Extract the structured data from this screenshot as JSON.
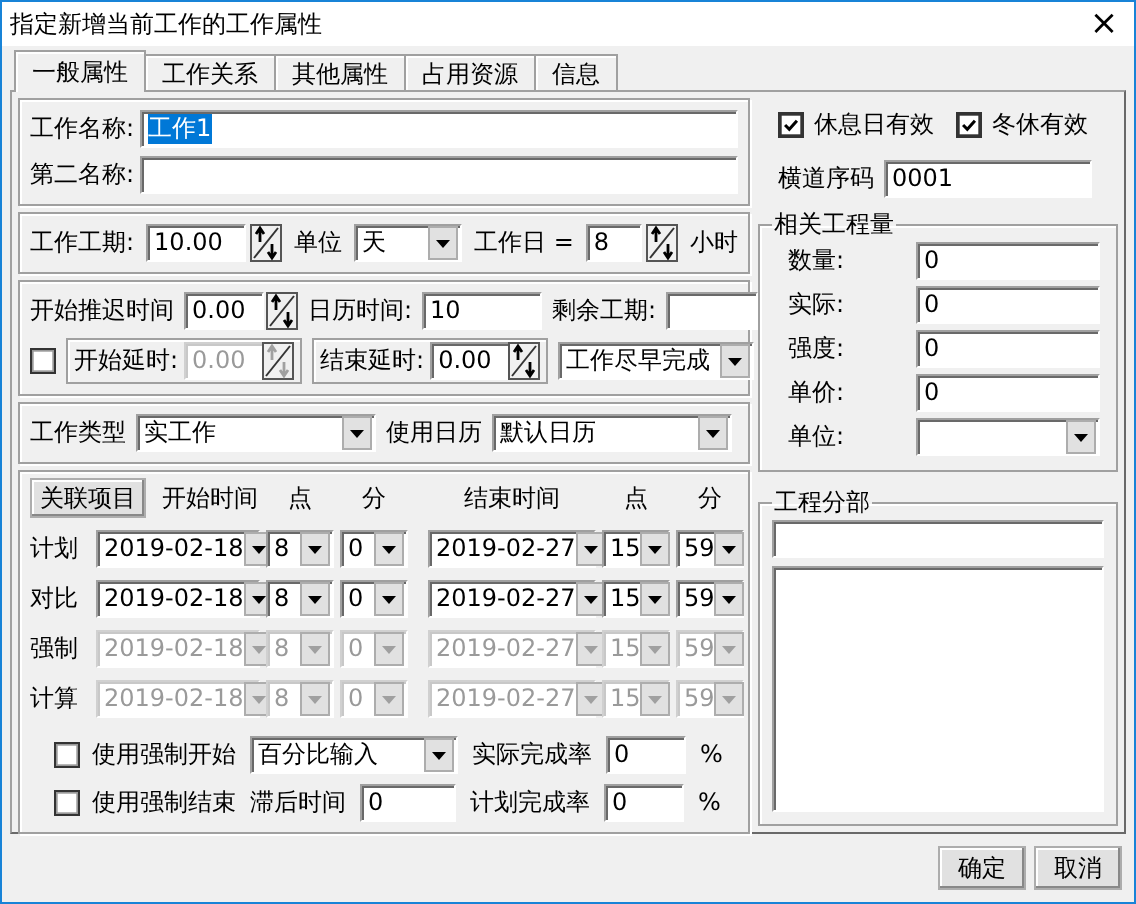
{
  "window": {
    "title": "指定新增当前工作的工作属性",
    "close_glyph": "×"
  },
  "tabs": [
    {
      "label": "一般属性",
      "selected": true
    },
    {
      "label": "工作关系",
      "selected": false
    },
    {
      "label": "其他属性",
      "selected": false
    },
    {
      "label": "占用资源",
      "selected": false
    },
    {
      "label": "信息",
      "selected": false
    }
  ],
  "name_field": {
    "label": "工作名称:",
    "value": "工作1",
    "text_selected": true
  },
  "second_name_field": {
    "label": "第二名称:"
  },
  "duration_row": [
    {
      "kind": "label",
      "text": "工作工期:"
    },
    {
      "kind": "spin",
      "value": "10.00",
      "disabled": false
    },
    {
      "kind": "label",
      "text": "单位"
    },
    {
      "kind": "select",
      "value": "天",
      "disabled": false
    },
    {
      "kind": "label",
      "text": "工作日 ="
    },
    {
      "kind": "spin",
      "value": "8",
      "disabled": false
    },
    {
      "kind": "label",
      "text": "小时"
    }
  ],
  "timing_row": [
    {
      "kind": "label",
      "text": "开始推迟时间"
    },
    {
      "kind": "spin",
      "value": "0.00",
      "disabled": false
    },
    {
      "kind": "label",
      "text": "日历时间:"
    },
    {
      "kind": "input",
      "value": "10",
      "disabled": false
    },
    {
      "kind": "label",
      "text": "剩余工期:"
    },
    {
      "kind": "input",
      "disabled": false
    }
  ],
  "delay_row": [
    {
      "kind": "checkbox",
      "checked": false
    },
    {
      "kind": "frame",
      "items": [
        {
          "kind": "label",
          "text": "开始延时:"
        },
        {
          "kind": "spin",
          "value": "0.00",
          "disabled": true
        }
      ]
    },
    {
      "kind": "frame",
      "items": [
        {
          "kind": "label",
          "text": "结束延时:"
        },
        {
          "kind": "spin",
          "value": "0.00",
          "disabled": false
        }
      ]
    },
    {
      "kind": "select",
      "value": "工作尽早完成",
      "disabled": false
    }
  ],
  "type_row": [
    {
      "kind": "label",
      "text": "工作类型"
    },
    {
      "kind": "select",
      "value": "实工作",
      "disabled": false
    },
    {
      "kind": "label",
      "text": "使用日历"
    },
    {
      "kind": "select",
      "value": "默认日历",
      "disabled": false
    }
  ],
  "schedule": {
    "header_button": "关联项目",
    "headers": [
      "开始时间",
      "点",
      "分",
      "结束时间",
      "点",
      "分"
    ],
    "rows": [
      {
        "label": "计划",
        "disabled": false,
        "values": [
          "2019-02-18",
          "8",
          "0",
          "2019-02-27",
          "15",
          "59"
        ]
      },
      {
        "label": "对比",
        "disabled": false,
        "values": [
          "2019-02-18",
          "8",
          "0",
          "2019-02-27",
          "15",
          "59"
        ]
      },
      {
        "label": "强制",
        "disabled": true,
        "values": [
          "2019-02-18",
          "8",
          "0",
          "2019-02-27",
          "15",
          "59"
        ]
      },
      {
        "label": "计算",
        "disabled": true,
        "values": [
          "2019-02-18",
          "8",
          "0",
          "2019-02-27",
          "15",
          "59"
        ]
      }
    ],
    "force_start_row": [
      {
        "kind": "checkbox",
        "label": "使用强制开始",
        "checked": false
      },
      {
        "kind": "select",
        "value": "百分比输入",
        "disabled": false
      },
      {
        "kind": "label",
        "text": "实际完成率"
      },
      {
        "kind": "input",
        "value": "0",
        "disabled": false
      },
      {
        "kind": "label",
        "text": "%"
      }
    ],
    "force_end_row": [
      {
        "kind": "checkbox",
        "label": "使用强制结束",
        "checked": false
      },
      {
        "kind": "label",
        "text": "滞后时间"
      },
      {
        "kind": "input",
        "value": "0",
        "disabled": false
      },
      {
        "kind": "label",
        "text": "计划完成率"
      },
      {
        "kind": "input",
        "value": "0",
        "disabled": false
      },
      {
        "kind": "label",
        "text": "%"
      }
    ]
  },
  "flags": [
    {
      "label": "休息日有效",
      "checked": true
    },
    {
      "label": "冬休有效",
      "checked": true
    }
  ],
  "bar_code": {
    "label": "横道序码",
    "value": "0001"
  },
  "quantities": {
    "title": "相关工程量",
    "fields": [
      {
        "kind": "input",
        "label": "数量:",
        "value": "0"
      },
      {
        "kind": "input",
        "label": "实际:",
        "value": "0"
      },
      {
        "kind": "input",
        "label": "强度:",
        "value": "0"
      },
      {
        "kind": "input",
        "label": "单价:",
        "value": "0"
      },
      {
        "kind": "select",
        "label": "单位:"
      }
    ]
  },
  "subdivision": {
    "title": "工程分部"
  },
  "buttons": [
    "确定",
    "取消"
  ]
}
